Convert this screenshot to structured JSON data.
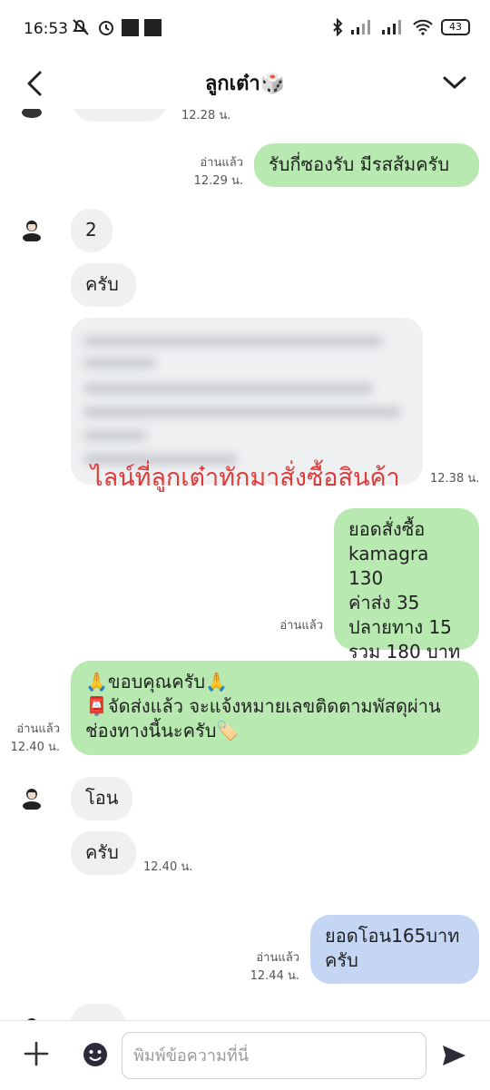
{
  "status_bar": {
    "time": "16:53",
    "battery": "43",
    "icons_left": [
      "mute-icon",
      "alarm-icon",
      "app-icon",
      "app-icon"
    ],
    "icons_right": [
      "bluetooth-icon",
      "signal-icon",
      "signal-icon",
      "wifi-icon",
      "battery-icon"
    ]
  },
  "header": {
    "title": "ลูกเต๋า🎲"
  },
  "messages": {
    "top_partial_time": "12.28 น.",
    "m1": {
      "text": "รับกี่ซองรับ มีรสส้มครับ",
      "read": "อ่านแล้ว",
      "time": "12.29 น."
    },
    "m2": {
      "text": "2"
    },
    "m3": {
      "text": "ครับ"
    },
    "m4": {
      "time": "12.38 น."
    },
    "m5": {
      "text": "ยอดสั่งซื้อ\nkamagra 130\nค่าส่ง 35\nปลายทาง 15\nรวม 180 บาท",
      "read": "อ่านแล้ว"
    },
    "m6": {
      "text": "🙏ขอบคุณครับ🙏\n📮จัดส่งแล้ว จะแจ้งหมายเลขติดตามพัสดุผ่าน\nช่องทางนี้นะครับ🏷️",
      "read": "อ่านแล้ว",
      "time": "12.40 น."
    },
    "m7": {
      "text": "โอน"
    },
    "m8": {
      "text": "ครับ",
      "time": "12.40 น."
    },
    "m9": {
      "text": "ยอดโอน165บาท\nครับ",
      "read": "อ่านแล้ว",
      "time": "12.44 น."
    }
  },
  "overlay_text": "ไลน์ที่ลูกเต๋าทักมาสั่งซื้อสินค้า",
  "input_bar": {
    "placeholder": "พิมพ์ข้อความที่นี่"
  },
  "colors": {
    "outgoing_bubble": "#b7e9b0",
    "incoming_bubble": "#eef0f2",
    "transfer_bubble": "#c5d6f5",
    "overlay_text": "#e03b3b"
  }
}
